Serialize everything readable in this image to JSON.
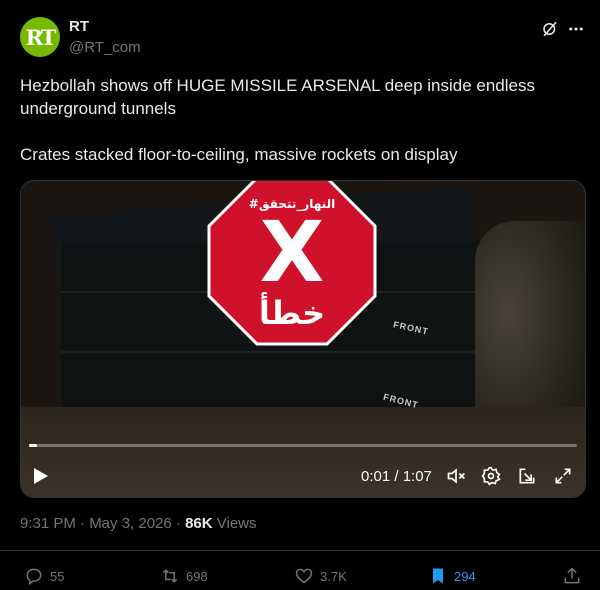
{
  "author": {
    "name": "RT",
    "handle": "@RT_com",
    "avatar_text": "RT",
    "avatar_color": "#77b900"
  },
  "header_icons": [
    "grok-icon",
    "more-icon"
  ],
  "post": {
    "line1": "Hezbollah shows off HUGE MISSILE ARSENAL deep inside endless underground tunnels",
    "line2": "Crates stacked floor-to-ceiling, massive rockets on display"
  },
  "media": {
    "overlay": {
      "label_top": "#النهار_تتحقق",
      "mark": "X",
      "label_bottom": "خطأ",
      "color": "#d0112b"
    },
    "crate_stamps": [
      "FRONT",
      "FRONT"
    ],
    "player": {
      "time": "0:01 / 1:07",
      "progress_fraction": 0.015
    },
    "controls": [
      "play-icon",
      "mute-icon",
      "settings-icon",
      "pop-out-icon",
      "fullscreen-icon"
    ]
  },
  "meta": {
    "timestamp": "9:31 PM · May 3, 2026 · ",
    "views_count": "86K",
    "views_label": " Views"
  },
  "actions": {
    "replies": "55",
    "reposts": "698",
    "likes": "3.7K",
    "bookmarks": "294",
    "bookmark_color": "#1d9bf0"
  }
}
